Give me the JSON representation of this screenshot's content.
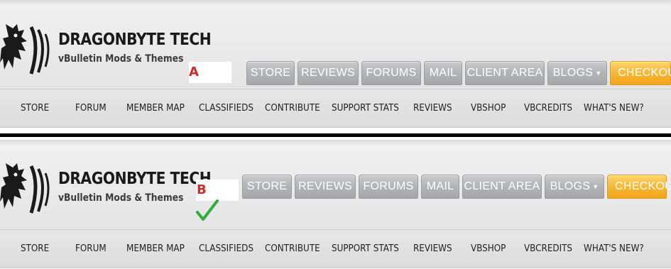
{
  "comparison": {
    "panels": [
      {
        "label": "A",
        "brand": {
          "title": "DRAGONBYTE TECH",
          "tagline": "vBulletin Mods & Themes"
        },
        "top_nav": [
          "STORE",
          "REVIEWS",
          "FORUMS",
          "MAIL",
          "CLIENT AREA",
          "BLOGS",
          "CHECKOUT"
        ],
        "sub_nav": [
          "STORE",
          "FORUM",
          "MEMBER MAP",
          "CLASSIFIEDS",
          "CONTRIBUTE",
          "SUPPORT STATS",
          "REVIEWS",
          "VBSHOP",
          "VBCREDITS",
          "WHAT'S NEW?"
        ]
      },
      {
        "label": "B",
        "brand": {
          "title": "DRAGONBYTE TECH",
          "tagline": "vBulletin Mods & Themes"
        },
        "top_nav": [
          "STORE",
          "REVIEWS",
          "FORUMS",
          "MAIL",
          "CLIENT AREA",
          "BLOGS",
          "CHECKOUT"
        ],
        "sub_nav": [
          "STORE",
          "FORUM",
          "MEMBER MAP",
          "CLASSIFIEDS",
          "CONTRIBUTE",
          "SUPPORT STATS",
          "REVIEWS",
          "VBSHOP",
          "VBCREDITS",
          "WHAT'S NEW?"
        ],
        "selected_mark": "checkmark-icon"
      }
    ]
  },
  "colors": {
    "label_red": "#d62828",
    "check_green": "#2eae3a",
    "checkout_orange": "#f7b531",
    "tab_gray": "#b3b5b8"
  }
}
